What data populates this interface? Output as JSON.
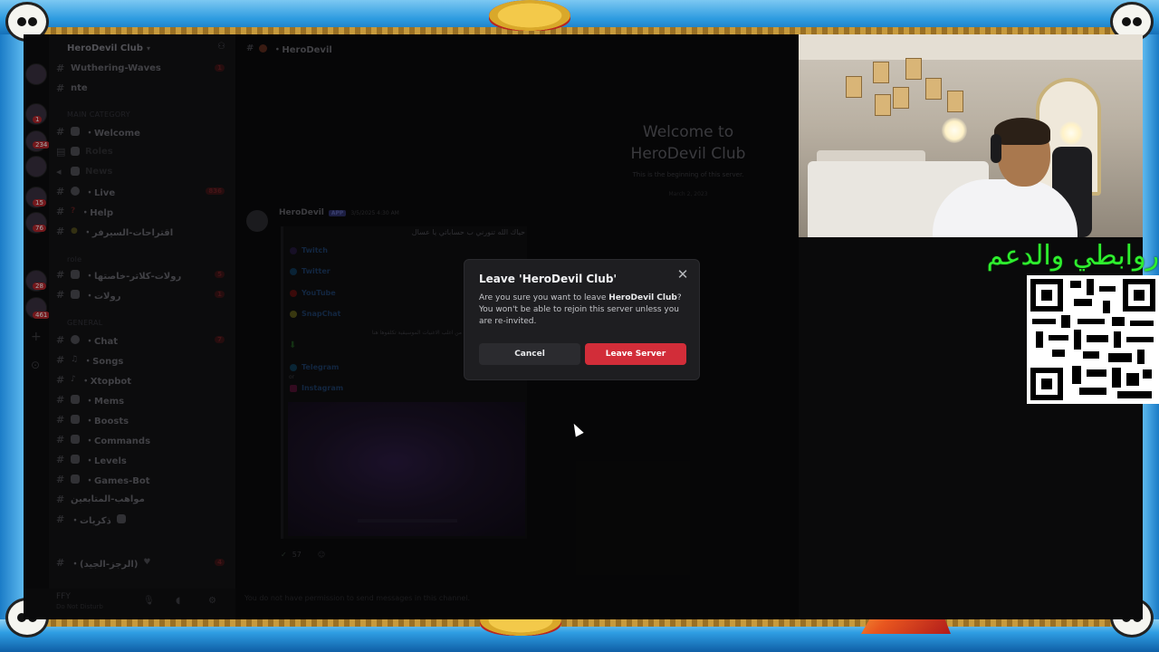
{
  "guild": {
    "name": "HeroDevil Club",
    "chevron": "chevron-down-icon"
  },
  "channels_top": [
    {
      "label": "Wuthering-Waves",
      "badge": "1"
    },
    {
      "label": "nte"
    }
  ],
  "categories": {
    "main": "MAIN CATEGORY",
    "role": "role",
    "general": "GENERAL"
  },
  "channels_main": [
    {
      "label": "・Welcome"
    },
    {
      "label": "Roles"
    },
    {
      "label": "News"
    },
    {
      "label": "・Live",
      "badge": "836"
    },
    {
      "label": "・Help"
    },
    {
      "label": "・اقتراحات-السيرفر"
    }
  ],
  "channels_role": [
    {
      "label": "・رولات-كلاتر-خاصتها",
      "badge": "5"
    },
    {
      "label": "・رولات",
      "badge": "1"
    }
  ],
  "channels_general": [
    {
      "label": "・Chat",
      "badge": "7"
    },
    {
      "label": "・Songs"
    },
    {
      "label": "・Xtopbot"
    },
    {
      "label": "・Mems"
    },
    {
      "label": "・Boosts"
    },
    {
      "label": "・Commands"
    },
    {
      "label": "・Levels"
    },
    {
      "label": "・Games-Bot"
    },
    {
      "label": "مواهب-المتابعين"
    },
    {
      "label": "・ذكريات"
    },
    {
      "label": "・(الرجز-الجيد)",
      "badge": "4"
    }
  ],
  "server_badges": [
    "1",
    "234",
    "15",
    "76",
    "28",
    "461"
  ],
  "user": {
    "name": "FFY",
    "status": "Do Not Disturb"
  },
  "channel_header": {
    "title": "・HeroDevil"
  },
  "welcome": {
    "title": "Welcome to HeroDevil Club",
    "subtitle": "This is the beginning of this server.",
    "date": "March 2, 2023"
  },
  "message": {
    "author": "HeroDevil",
    "app_tag": "APP",
    "time": "3/5/2025 4:30 AM",
    "greeting": "حياك الله تنورني ب حساباتي يا عسال",
    "links": [
      {
        "label": "Twitch",
        "color": "#6441a5"
      },
      {
        "label": "Twitter",
        "color": "#1d9bf0"
      },
      {
        "label": "YouTube",
        "color": "#ff0000"
      },
      {
        "label": "SnapChat",
        "color": "#fffc00"
      }
    ],
    "music_note": "من اغلب الاغنيات الموسيقية تكلفوها هنا",
    "or": "or",
    "links2": [
      {
        "label": "Telegram",
        "color": "#2aabee"
      },
      {
        "label": "Instagram",
        "color": "#e1306c"
      }
    ],
    "reaction_count": "57"
  },
  "composer": {
    "placeholder": "You do not have permission to send messages in this channel."
  },
  "modal": {
    "title": "Leave 'HeroDevil Club'",
    "body_pre": "Are you sure you want to leave ",
    "body_server": "HeroDevil Club",
    "body_post": "? You won't be able to rejoin this server unless you are re-invited.",
    "cancel_label": "Cancel",
    "leave_label": "Leave Server",
    "leave_color": "#d22d39"
  },
  "overlay": {
    "links_label": "روابطي والدعم"
  }
}
